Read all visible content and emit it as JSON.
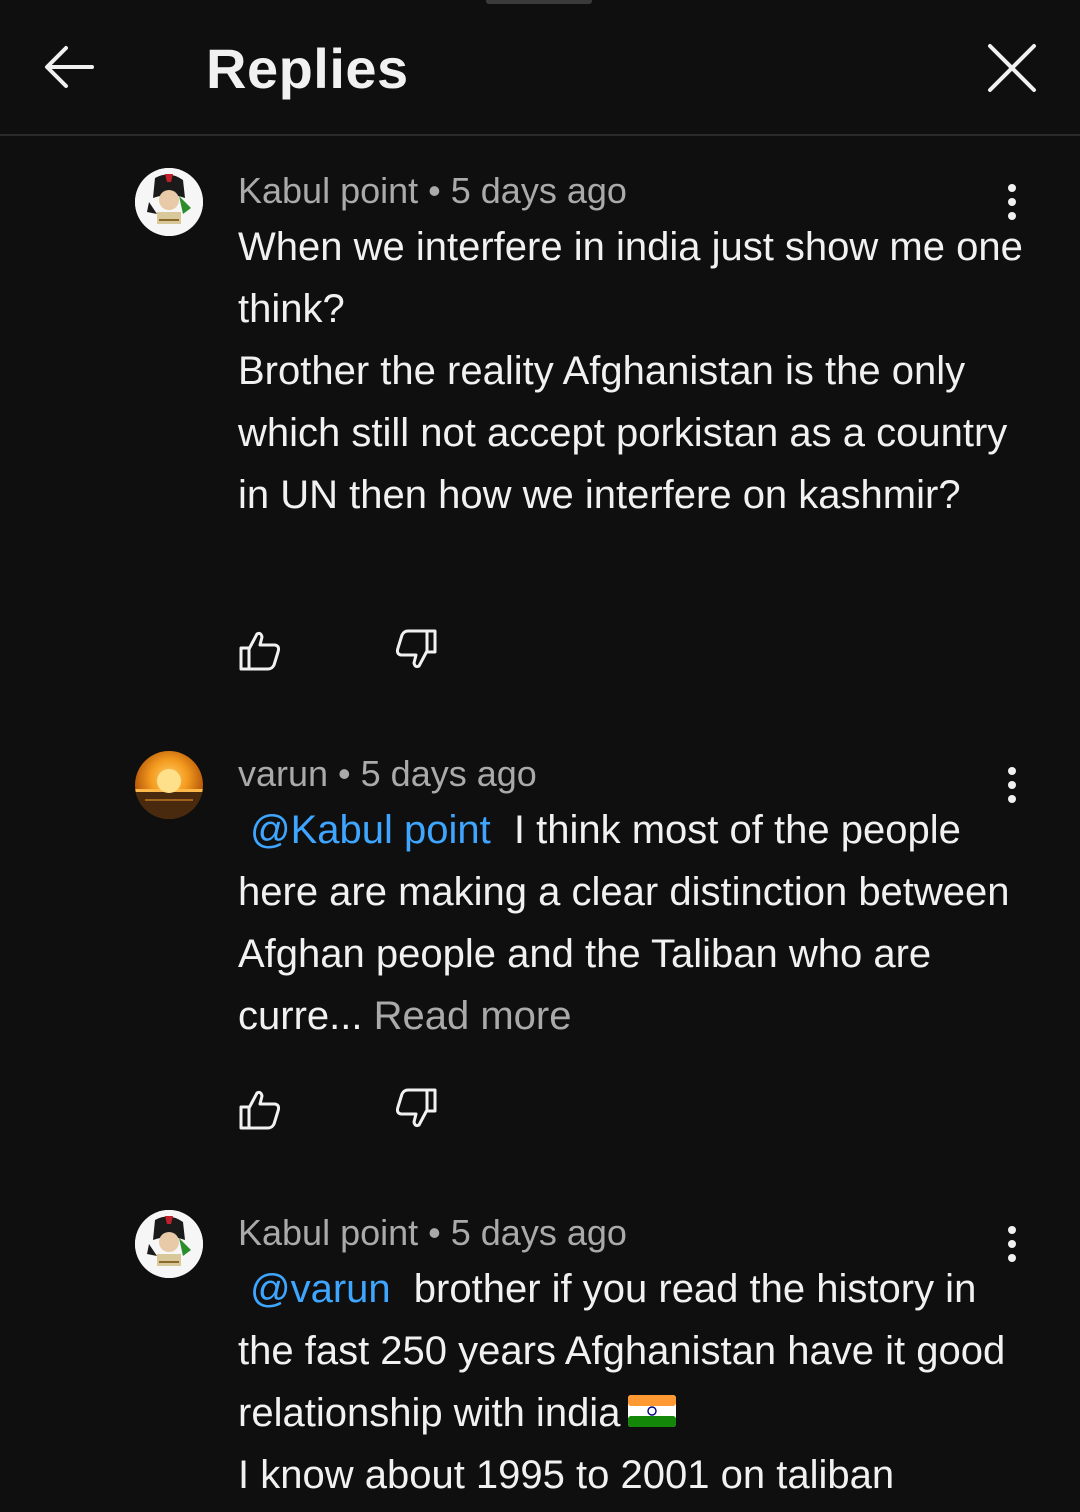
{
  "header": {
    "title": "Replies"
  },
  "comments": [
    {
      "author": "Kabul point",
      "meta": "Kabul point • 5 days ago",
      "text": "When we interfere in india just show me one think?\nBrother the reality Afghanistan is the only which still not accept porkistan as a country in UN then how we interfere on kashmir?"
    },
    {
      "author": "varun",
      "meta": "varun • 5 days ago",
      "mention": "@Kabul point",
      "text": "I think most of the people here are making a clear distinction between Afghan people and the Taliban who are curre...",
      "read_more": "Read more"
    },
    {
      "author": "Kabul point",
      "meta": "Kabul point • 5 days ago",
      "mention": "@varun",
      "text_before_flag": "brother if you read the history in the fast 250 years Afghanistan have it good relationship with india",
      "text_after_flag": "I know about 1995 to 2001 on taliban"
    }
  ],
  "colors": {
    "background": "#0f0f0f",
    "primary_text": "#f1f1f1",
    "secondary_text": "#aaaaaa",
    "mention": "#3ea6ff"
  },
  "icons": [
    "back-arrow-icon",
    "close-icon",
    "more-vert-icon",
    "thumb-up-icon",
    "thumb-down-icon",
    "india-flag-emoji"
  ]
}
